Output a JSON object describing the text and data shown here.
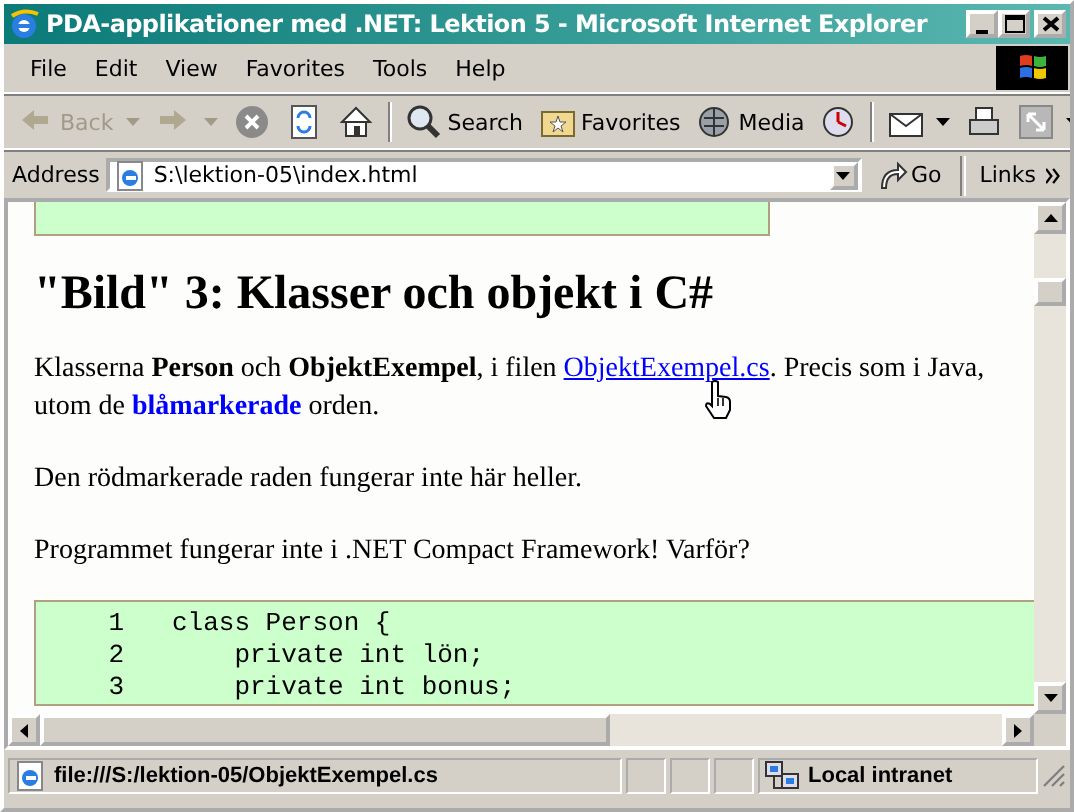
{
  "window": {
    "title": "PDA-applikationer med .NET: Lektion 5 - Microsoft Internet Explorer"
  },
  "menu": [
    "File",
    "Edit",
    "View",
    "Favorites",
    "Tools",
    "Help"
  ],
  "toolbar": [
    {
      "kind": "back",
      "label": "Back",
      "disabled": true,
      "dropdown": true
    },
    {
      "kind": "forward",
      "disabled": true,
      "dropdown": true
    },
    {
      "kind": "stop"
    },
    {
      "kind": "refresh"
    },
    {
      "kind": "home"
    },
    {
      "kind": "search",
      "label": "Search",
      "sep": true
    },
    {
      "kind": "favorites",
      "label": "Favorites"
    },
    {
      "kind": "media",
      "label": "Media"
    },
    {
      "kind": "history"
    },
    {
      "kind": "mail",
      "dropdown": true,
      "sep": true
    },
    {
      "kind": "print"
    },
    {
      "kind": "edit",
      "dropdown": true
    }
  ],
  "address": {
    "label": "Address",
    "value": "S:\\lektion-05\\index.html",
    "go": "Go",
    "links": "Links"
  },
  "page": {
    "heading": "\"Bild\" 3: Klasser och objekt i C#",
    "paragraphs": [
      [
        {
          "kind": "plain",
          "text": "Klasserna "
        },
        {
          "kind": "bold",
          "text": "Person"
        },
        {
          "kind": "plain",
          "text": " och "
        },
        {
          "kind": "bold",
          "text": "ObjektExempel"
        },
        {
          "kind": "plain",
          "text": ", i filen "
        },
        {
          "kind": "link",
          "text": "ObjektExempel.cs"
        },
        {
          "kind": "plain",
          "text": ". Precis som i Java, utom de "
        },
        {
          "kind": "highlight",
          "text": "blåmarkerade"
        },
        {
          "kind": "plain",
          "text": " orden."
        }
      ],
      [
        {
          "kind": "plain",
          "text": "Den rödmarkerade raden fungerar inte här heller."
        }
      ],
      [
        {
          "kind": "plain",
          "text": "Programmet fungerar inte i .NET Compact Framework! Varför?"
        }
      ]
    ],
    "code": [
      {
        "number": "1",
        "code": "class Person {"
      },
      {
        "number": "2",
        "code": "    private int lön;"
      },
      {
        "number": "3",
        "code": "    private int bonus;"
      }
    ]
  },
  "status_bar": {
    "text": "file:///S:/lektion-05/ObjektExempel.cs",
    "zone": "Local intranet"
  }
}
